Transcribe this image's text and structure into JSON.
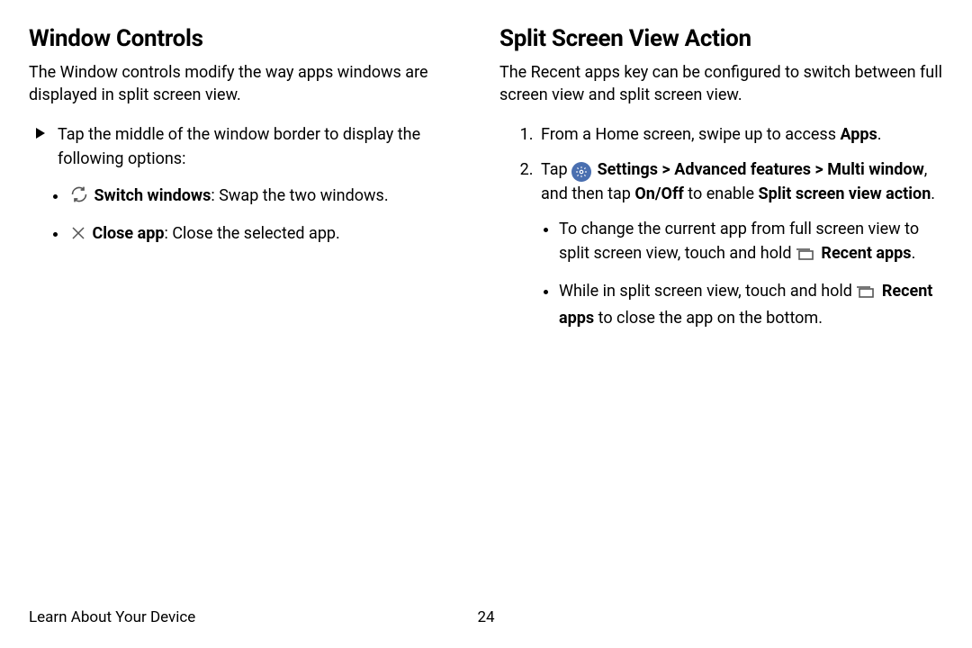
{
  "left": {
    "heading": "Window Controls",
    "intro": "The Window controls modify the way apps windows are displayed in split screen view.",
    "arrow_intro": "Tap the middle of the window border to display the following options:",
    "switch_label": "Switch windows",
    "switch_desc": ": Swap the two windows.",
    "close_label": "Close app",
    "close_desc": ": Close the selected app."
  },
  "right": {
    "heading": "Split Screen View Action",
    "intro": "The Recent apps key can be configured to switch between full screen view and split screen view.",
    "step1_prefix": "From a Home screen, swipe up to access ",
    "step1_bold": "Apps",
    "step1_suffix": ".",
    "step2_tap": "Tap ",
    "step2_settings": "Settings",
    "step2_chev1": " > ",
    "step2_adv": "Advanced features",
    "step2_chev2": " > ",
    "step2_multi": "Multi window",
    "step2_mid": ", and then tap ",
    "step2_onoff": "On/Off",
    "step2_enable": " to enable ",
    "step2_action": "Split screen view action",
    "step2_end": ".",
    "sub1_prefix": "To change the current app from full screen view to split screen view, touch and hold ",
    "sub1_recent": "Recent apps",
    "sub1_suffix": ".",
    "sub2_prefix": "While in split screen view, touch and hold ",
    "sub2_recent": "Recent apps",
    "sub2_suffix": " to close the app on the bottom."
  },
  "footer": {
    "label": "Learn About Your Device",
    "page": "24"
  }
}
